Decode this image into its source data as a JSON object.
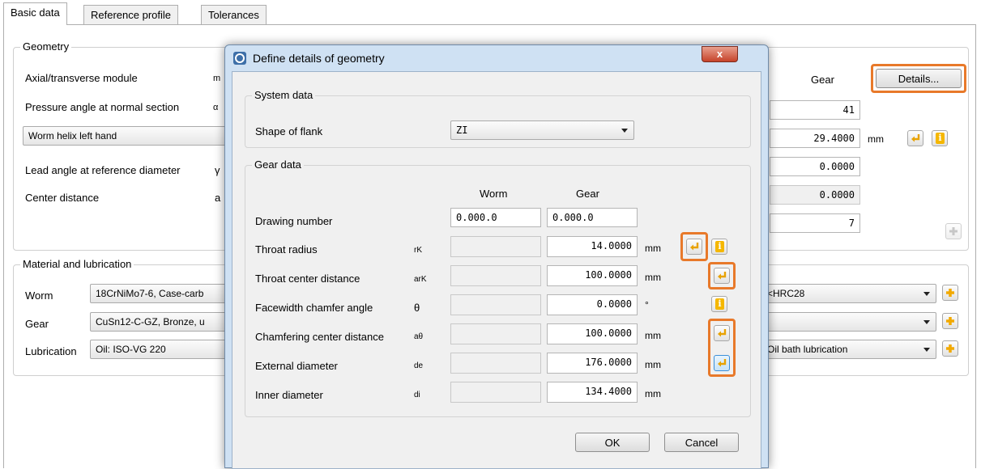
{
  "tabs": [
    "Basic data",
    "Reference profile",
    "Tolerances"
  ],
  "geometry": {
    "legend": "Geometry",
    "rows": [
      {
        "label": "Axial/transverse module",
        "sym": "m"
      },
      {
        "label": "Pressure angle at normal section",
        "sym": "α"
      },
      {
        "label": "Worm helix left hand"
      },
      {
        "label": "Lead angle at reference diameter",
        "sym": "γ"
      },
      {
        "label": "Center distance",
        "sym": "a"
      }
    ],
    "gear_header": "Gear",
    "details_button": "Details...",
    "values": [
      "41",
      "29.4000",
      "0.0000",
      "0.0000",
      "7"
    ],
    "unit_mm": "mm"
  },
  "material": {
    "legend": "Material and lubrication",
    "worm_label": "Worm",
    "worm_value": "18CrNiMo7-6, Case-carb",
    "worm_right": "<HRC28",
    "gear_label": "Gear",
    "gear_value": "CuSn12-C-GZ, Bronze, u",
    "gear_right": "",
    "lub_label": "Lubrication",
    "lub_value": "Oil: ISO-VG 220",
    "lub_right": "Oil bath lubrication"
  },
  "dialog": {
    "title": "Define details of geometry",
    "close": "x",
    "system_legend": "System data",
    "shape_label": "Shape of flank",
    "shape_value": "ZI",
    "gear_legend": "Gear data",
    "col_worm": "Worm",
    "col_gear": "Gear",
    "drawing_label": "Drawing number",
    "drawing_worm": "0.000.0",
    "drawing_gear": "0.000.0",
    "rows": [
      {
        "label": "Throat radius",
        "sym": "rK",
        "value": "14.0000",
        "unit": "mm"
      },
      {
        "label": "Throat center distance",
        "sym": "arK",
        "value": "100.0000",
        "unit": "mm"
      },
      {
        "label": "Facewidth chamfer angle",
        "sym": "θ",
        "value": "0.0000",
        "unit": "°"
      },
      {
        "label": "Chamfering center distance",
        "sym": "aθ",
        "value": "100.0000",
        "unit": "mm"
      },
      {
        "label": "External diameter",
        "sym": "de",
        "value": "176.0000",
        "unit": "mm"
      },
      {
        "label": "Inner diameter",
        "sym": "di",
        "value": "134.4000",
        "unit": "mm"
      }
    ],
    "ok": "OK",
    "cancel": "Cancel"
  },
  "colors": {
    "highlight": "#e8792a",
    "info": "#f5b700",
    "dialog_frame": "#cfe1f3"
  },
  "icons": [
    "enter-arrow-icon",
    "info-icon",
    "plus-icon",
    "dropdown-arrow-icon",
    "app-icon",
    "close-icon"
  ]
}
